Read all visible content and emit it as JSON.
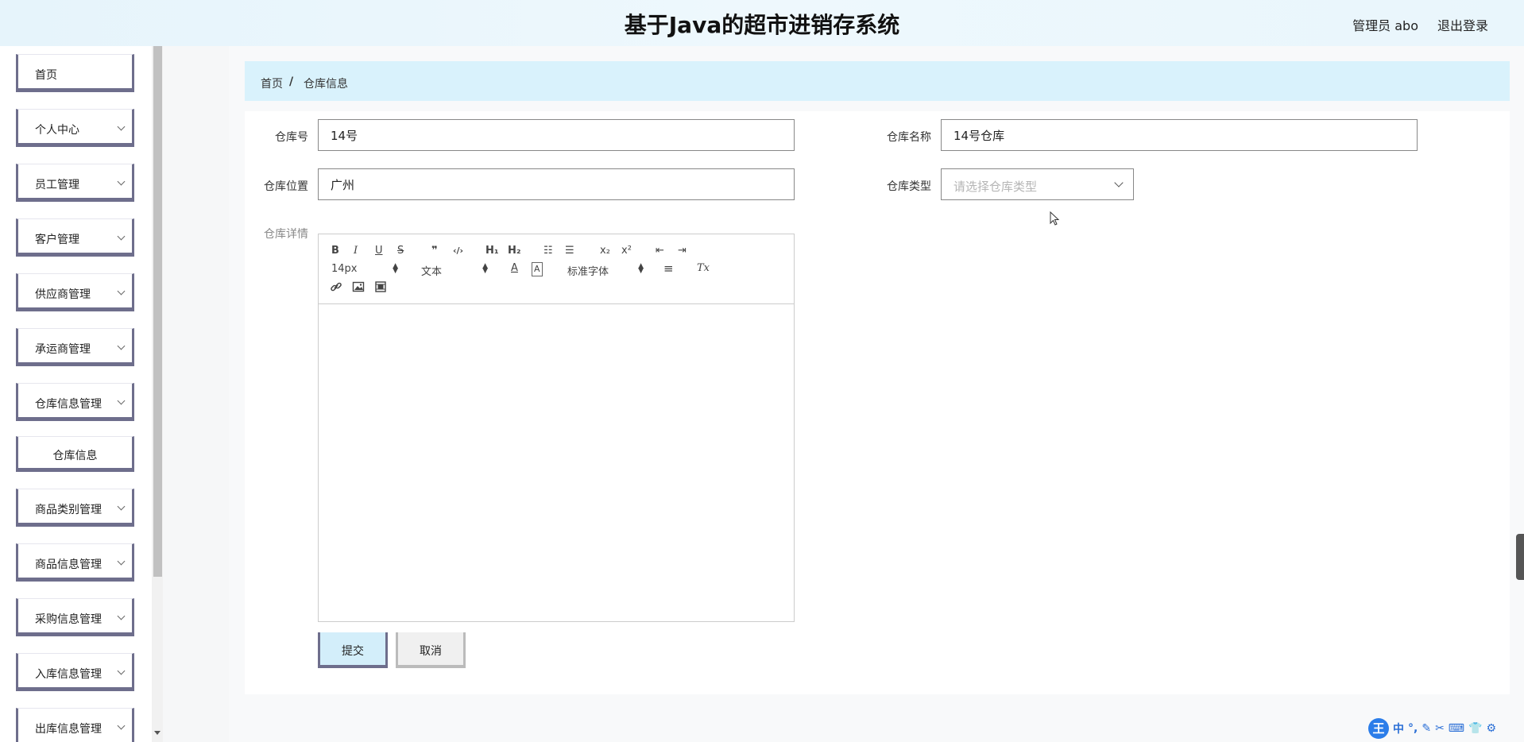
{
  "header": {
    "title": "基于Java的超市进销存系统",
    "user": "管理员 abo",
    "logout": "退出登录"
  },
  "sidebar": {
    "items": [
      {
        "label": "首页",
        "has_chevron": false
      },
      {
        "label": "个人中心",
        "has_chevron": true
      },
      {
        "label": "员工管理",
        "has_chevron": true
      },
      {
        "label": "客户管理",
        "has_chevron": true
      },
      {
        "label": "供应商管理",
        "has_chevron": true
      },
      {
        "label": "承运商管理",
        "has_chevron": true
      },
      {
        "label": "仓库信息管理",
        "has_chevron": true,
        "expanded": true
      },
      {
        "label": "仓库信息",
        "submenu": true
      },
      {
        "label": "商品类别管理",
        "has_chevron": true
      },
      {
        "label": "商品信息管理",
        "has_chevron": true
      },
      {
        "label": "采购信息管理",
        "has_chevron": true
      },
      {
        "label": "入库信息管理",
        "has_chevron": true
      },
      {
        "label": "出库信息管理",
        "has_chevron": true
      }
    ]
  },
  "breadcrumb": {
    "home": "首页",
    "separator": "/",
    "current": "仓库信息"
  },
  "form": {
    "warehouse_no_label": "仓库号",
    "warehouse_no_value": "14号",
    "warehouse_name_label": "仓库名称",
    "warehouse_name_value": "14号仓库",
    "location_label": "仓库位置",
    "location_value": "广州",
    "type_label": "仓库类型",
    "type_placeholder": "请选择仓库类型",
    "detail_label": "仓库详情"
  },
  "editor": {
    "toolbar": {
      "bold": "B",
      "italic": "I",
      "underline": "U",
      "strike": "S",
      "blockquote": "❞",
      "code": "‹/›",
      "h1": "H₁",
      "h2": "H₂",
      "ordered_list": "☷",
      "bullet_list": "☰",
      "subscript": "x₂",
      "superscript": "x²",
      "outdent": "⇤",
      "indent": "⇥",
      "size": "14px",
      "header": "文本",
      "color": "A",
      "background": "A",
      "font": "标准字体",
      "align": "≡",
      "clean": "Tx"
    }
  },
  "buttons": {
    "submit": "提交",
    "cancel": "取消"
  },
  "colors": {
    "accent_border": "#6e6e8c",
    "header_bg": "#e6f4fb",
    "breadcrumb_bg": "#d9f2fc",
    "submit_bg": "#d3eefa"
  },
  "ime": {
    "logo": "王",
    "mode": "中"
  }
}
